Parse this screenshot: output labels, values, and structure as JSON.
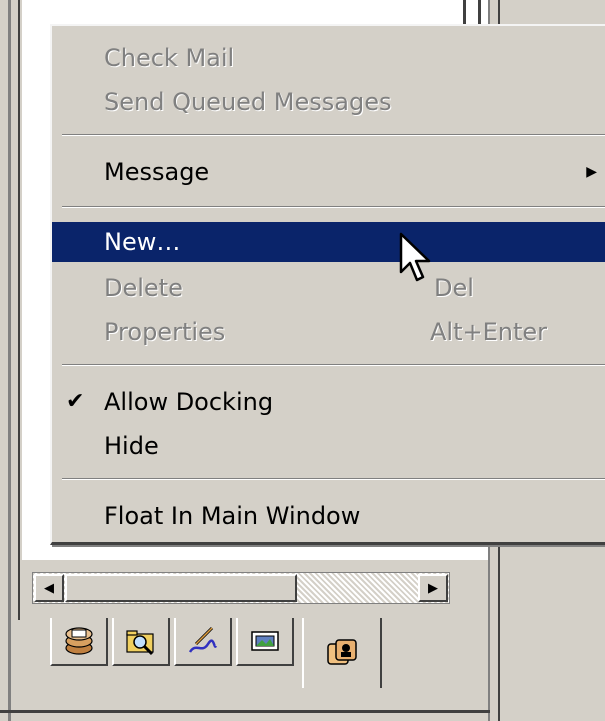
{
  "context_menu": {
    "check_mail": "Check Mail",
    "send_queued": "Send Queued Messages",
    "message": "Message",
    "new": "New…",
    "delete": "Delete",
    "delete_shortcut": "Del",
    "properties": "Properties",
    "properties_shortcut": "Alt+Enter",
    "allow_docking": "Allow Docking",
    "allow_docking_checked": true,
    "hide": "Hide",
    "float_in_main_window": "Float In Main Window",
    "highlighted_item": "New…"
  },
  "icons": {
    "submenu_arrow": "triangle-right-icon",
    "check": "checkmark-icon",
    "cursor": "arrow-cursor-icon",
    "scroll_left": "scroll-left-arrow-icon",
    "scroll_right": "scroll-right-arrow-icon",
    "tabs": [
      "mail-stack-icon",
      "folder-search-icon",
      "pen-signature-icon",
      "mailbox-icon",
      "people-cards-icon"
    ]
  },
  "tab_strip": {
    "active_tab_index": 4
  },
  "colors": {
    "menu_background": "#d4d0c8",
    "highlight": "#0a246a",
    "disabled_text": "#808080"
  }
}
